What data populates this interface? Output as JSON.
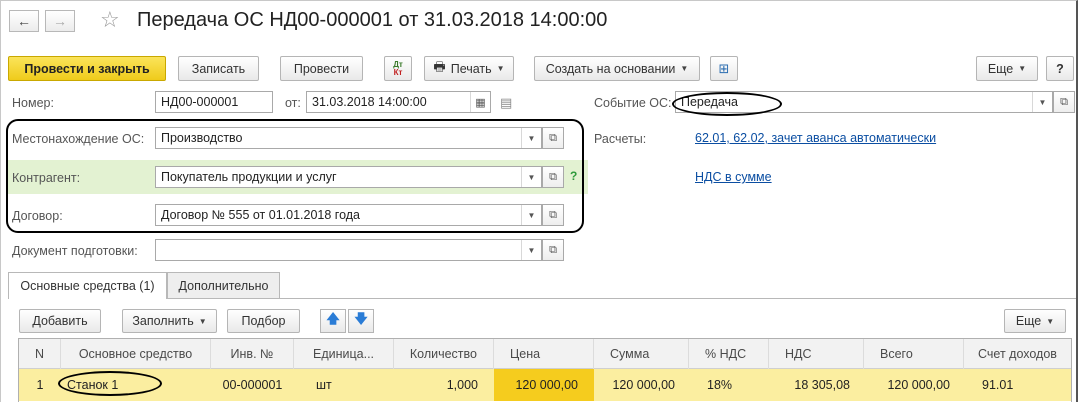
{
  "window": {
    "title": "Передача ОС НД00-000001 от 31.03.2018 14:00:00",
    "nav_back": "←",
    "nav_forward": "→",
    "star": "☆"
  },
  "toolbar": {
    "post_close": "Провести и закрыть",
    "save": "Записать",
    "post": "Провести",
    "dtkt_top": "Дт",
    "dtkt_bottom": "Кт",
    "print": "Печать",
    "create_based": "Создать на основании",
    "more": "Еще",
    "help": "?"
  },
  "form": {
    "number_label": "Номер:",
    "number_value": "НД00-000001",
    "date_label": "от:",
    "date_value": "31.03.2018 14:00:00",
    "event_label": "Событие ОС:",
    "event_value": "Передача",
    "location_label": "Местонахождение ОС:",
    "location_value": "Производство",
    "settlements_label": "Расчеты:",
    "settlements_link": "62.01, 62.02, зачет аванса автоматически",
    "counterparty_label": "Контрагент:",
    "counterparty_value": "Покупатель продукции и услуг",
    "counterparty_help": "?",
    "vat_link": "НДС в сумме",
    "contract_label": "Договор:",
    "contract_value": "Договор № 555 от 01.01.2018 года",
    "prep_doc_label": "Документ подготовки:",
    "prep_doc_value": ""
  },
  "tabs": [
    {
      "label": "Основные средства (1)",
      "active": true
    },
    {
      "label": "Дополнительно",
      "active": false
    }
  ],
  "table_toolbar": {
    "add": "Добавить",
    "fill": "Заполнить",
    "select": "Подбор",
    "more": "Еще"
  },
  "table": {
    "columns": [
      "N",
      "Основное средство",
      "Инв. №",
      "Единица...",
      "Количество",
      "Цена",
      "Сумма",
      "% НДС",
      "НДС",
      "Всего",
      "Счет доходов"
    ],
    "rows": [
      [
        "1",
        "Станок 1",
        "00-000001",
        "шт",
        "1,000",
        "120 000,00",
        "120 000,00",
        "18%",
        "18 305,08",
        "120 000,00",
        "91.01"
      ]
    ]
  },
  "colors": {
    "primary_button": "#f0cf22",
    "selected_row": "#fbeea0",
    "selected_cell": "#f5cc1e",
    "highlight_row": "#e3f2d2",
    "link": "#0b4ea2"
  }
}
